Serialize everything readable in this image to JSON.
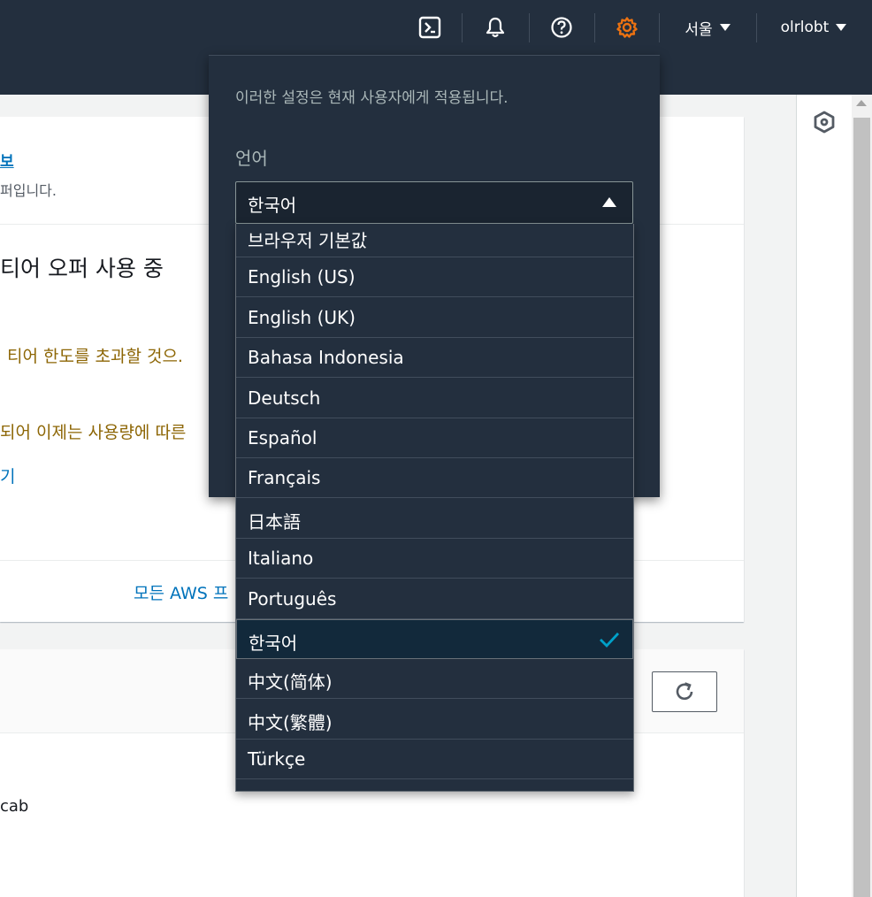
{
  "topnav": {
    "icons": [
      "cloudshell-icon",
      "bell-icon",
      "help-icon",
      "gear-icon"
    ],
    "region": "서울",
    "account": "olrlobt",
    "accent_color": "#ec7211"
  },
  "background": {
    "card1": {
      "link_fragment": "보",
      "subtitle_fragment": "퍼입니다.",
      "heading_fragment": "티어 오퍼 사용 중",
      "warning1_fragment": "티어 한도를 초과할 것으.",
      "warning2_fragment": "되어 이제는 사용량에 따른",
      "link2_fragment": "기",
      "footer_link_fragment": "모든 AWS 프"
    },
    "card2": {
      "row_text_fragment": "cab"
    }
  },
  "settings": {
    "note": "이러한 설정은 현재 사용자에게 적용됩니다.",
    "language_label": "언어",
    "selected_value": "한국어",
    "options": [
      "브라우저 기본값",
      "English (US)",
      "English (UK)",
      "Bahasa Indonesia",
      "Deutsch",
      "Español",
      "Français",
      "日本語",
      "Italiano",
      "Português",
      "한국어",
      "中文(简体)",
      "中文(繁體)",
      "Türkçe"
    ],
    "selected_index": 10,
    "check_color": "#00a1c9"
  }
}
